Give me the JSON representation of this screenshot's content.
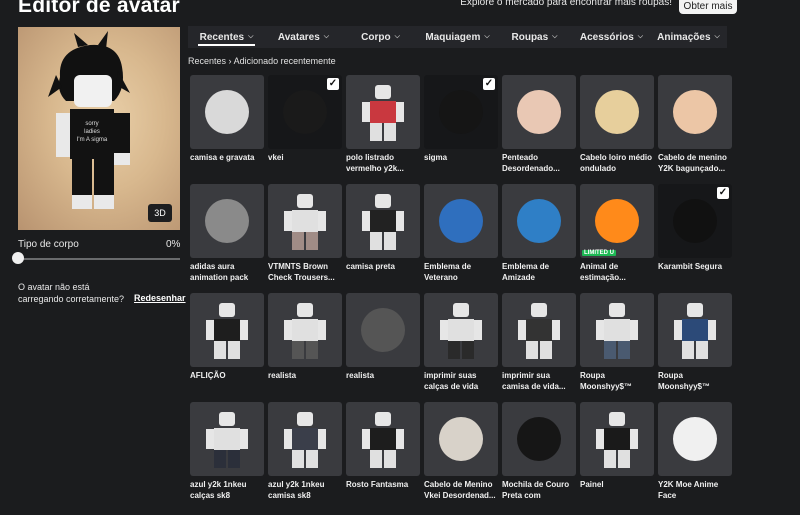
{
  "header": {
    "title": "Editor de avatar",
    "promo_text": "Explore o mercado para encontrar mais roupas!",
    "promo_button": "Obter mais"
  },
  "preview": {
    "view_button": "3D",
    "shirt_text_1": "sorry",
    "shirt_text_2": "ladies",
    "shirt_text_3": "I'm A sigma"
  },
  "body_type": {
    "label": "Tipo de corpo",
    "value": "0%",
    "level": 0
  },
  "warning": {
    "text": "O avatar não está carregando corretamente?",
    "link": "Redesenhar"
  },
  "tabs": [
    {
      "label": "Recentes"
    },
    {
      "label": "Avatares"
    },
    {
      "label": "Corpo"
    },
    {
      "label": "Maquiagem"
    },
    {
      "label": "Roupas"
    },
    {
      "label": "Acessórios"
    },
    {
      "label": "Animações"
    }
  ],
  "breadcrumb": {
    "root": "Recentes",
    "current": "Adicionado recentemente"
  },
  "items": [
    {
      "label": "camisa e gravata",
      "shirt": "#d9d9d9",
      "pants": "#d9d9d9",
      "checked": false
    },
    {
      "label": "vkei",
      "shirt": "#1a1a1a",
      "pants": "#1a1a1a",
      "checked": true
    },
    {
      "label": "polo listrado vermelho y2k...",
      "shirt": "#c9383f",
      "pants": "#e0e0e0",
      "checked": false
    },
    {
      "label": "sigma",
      "shirt": "#151515",
      "pants": "#151515",
      "checked": true
    },
    {
      "label": "Penteado Desordenado...",
      "shirt": "#e9c8b4",
      "pants": "#e9c8b4",
      "checked": false
    },
    {
      "label": "Cabelo loiro médio ondulado",
      "shirt": "#e7cf9c",
      "pants": "#e7cf9c",
      "checked": false
    },
    {
      "label": "Cabelo de menino Y2K bagunçado...",
      "shirt": "#ecc6a6",
      "pants": "#ecc6a6",
      "checked": false
    },
    {
      "label": "adidas aura animation pack",
      "shirt": "#8a8a8a",
      "pants": "#8a8a8a",
      "checked": false
    },
    {
      "label": "VTMNTS Brown Check Trousers...",
      "shirt": "#e0e0e0",
      "pants": "#a08c86",
      "checked": false
    },
    {
      "label": "camisa preta",
      "shirt": "#222222",
      "pants": "#e0e0e0",
      "checked": false
    },
    {
      "label": "Emblema de Veterano",
      "shirt": "#2f6fbe",
      "pants": "#2f6fbe",
      "checked": false
    },
    {
      "label": "Emblema de Amizade",
      "shirt": "#2f7fc6",
      "pants": "#2f7fc6",
      "checked": false
    },
    {
      "label": "Animal de estimação...",
      "shirt": "#ff8a1a",
      "pants": "#ff8a1a",
      "checked": false,
      "badge": "LIMITED U"
    },
    {
      "label": "Karambit Segura",
      "shirt": "#111111",
      "pants": "#111111",
      "checked": true
    },
    {
      "label": "AFLIÇÃO",
      "shirt": "#1e1e1e",
      "pants": "#e0e0e0",
      "checked": false
    },
    {
      "label": "realista",
      "shirt": "#e0e0e0",
      "pants": "#555555",
      "checked": false
    },
    {
      "label": "realista",
      "shirt": "#555555",
      "pants": "#555555",
      "checked": false
    },
    {
      "label": "imprimir suas calças de vida em...",
      "shirt": "#e0e0e0",
      "pants": "#2a2a2a",
      "checked": false
    },
    {
      "label": "imprimir sua camisa de vida...",
      "shirt": "#333333",
      "pants": "#e0e0e0",
      "checked": false
    },
    {
      "label": "Roupa Moonshyy$™",
      "shirt": "#e0e0e0",
      "pants": "#4a5a70",
      "checked": false
    },
    {
      "label": "Roupa Moonshyy$™",
      "shirt": "#2c4a78",
      "pants": "#e0e0e0",
      "checked": false
    },
    {
      "label": "azul y2k 1nkeu calças sk8",
      "shirt": "#e0e0e0",
      "pants": "#2b2f3a",
      "checked": false
    },
    {
      "label": "azul y2k 1nkeu camisa sk8",
      "shirt": "#3a3e4a",
      "pants": "#e0e0e0",
      "checked": false
    },
    {
      "label": "Rosto Fantasma",
      "shirt": "#1d1d1d",
      "pants": "#e0e0e0",
      "checked": false
    },
    {
      "label": "Cabelo de Menino Vkei Desordenad...",
      "shirt": "#d8d2c9",
      "pants": "#d8d2c9",
      "checked": false
    },
    {
      "label": "Mochila de Couro Preta com Cruzes...",
      "shirt": "#161616",
      "pants": "#161616",
      "checked": false
    },
    {
      "label": "Painel",
      "shirt": "#1a1a1a",
      "pants": "#e0e0e0",
      "checked": false
    },
    {
      "label": "Y2K Moe Anime Face",
      "shirt": "#f0f0f0",
      "pants": "#f0f0f0",
      "checked": false
    }
  ]
}
